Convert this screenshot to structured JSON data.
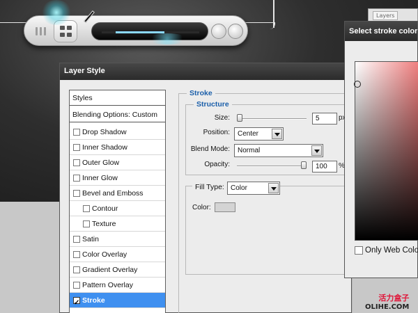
{
  "layer_style": {
    "title": "Layer Style",
    "styles_list": [
      {
        "label": "Styles",
        "type": "head"
      },
      {
        "label": "Blending Options: Custom",
        "type": "head"
      },
      {
        "label": "Drop Shadow",
        "type": "item",
        "checked": false
      },
      {
        "label": "Inner Shadow",
        "type": "item",
        "checked": false
      },
      {
        "label": "Outer Glow",
        "type": "item",
        "checked": false
      },
      {
        "label": "Inner Glow",
        "type": "item",
        "checked": false
      },
      {
        "label": "Bevel and Emboss",
        "type": "item",
        "checked": false
      },
      {
        "label": "Contour",
        "type": "sub",
        "checked": false
      },
      {
        "label": "Texture",
        "type": "sub",
        "checked": false
      },
      {
        "label": "Satin",
        "type": "item",
        "checked": false
      },
      {
        "label": "Color Overlay",
        "type": "item",
        "checked": false
      },
      {
        "label": "Gradient Overlay",
        "type": "item",
        "checked": false
      },
      {
        "label": "Pattern Overlay",
        "type": "item",
        "checked": false
      },
      {
        "label": "Stroke",
        "type": "item",
        "checked": true,
        "active": true
      }
    ],
    "stroke": {
      "section_title": "Stroke",
      "structure_title": "Structure",
      "size_label": "Size:",
      "size_value": "5",
      "size_unit": "px",
      "position_label": "Position:",
      "position_value": "Center",
      "blend_mode_label": "Blend Mode:",
      "blend_mode_value": "Normal",
      "opacity_label": "Opacity:",
      "opacity_value": "100",
      "opacity_unit": "%",
      "fill_type_label": "Fill Type:",
      "fill_type_value": "Color",
      "color_label": "Color:"
    }
  },
  "color_picker": {
    "title": "Select stroke color:",
    "only_web_colors_label": "Only Web Colors"
  },
  "layers_tab": "Layers",
  "watermark": {
    "cn": "活力盒子",
    "en": "OLIHE.COM"
  },
  "colors": {
    "accent": "#3f90f0",
    "section_title": "#1b5faa",
    "watermark_red": "#e0173a"
  }
}
